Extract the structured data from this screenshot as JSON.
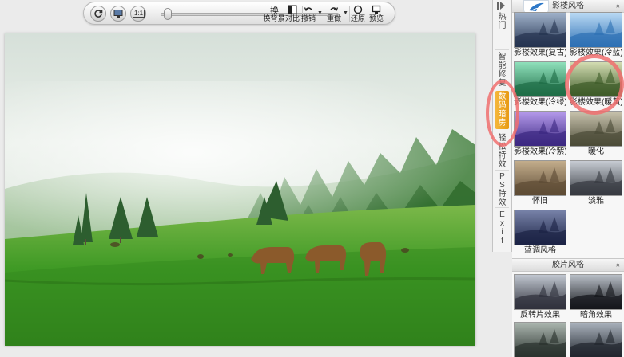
{
  "toolbar": {
    "rotate_icon": "rotate-icon",
    "fit_screen_icon": "monitor-icon",
    "actual_size_label": "1:1",
    "zoom_level": 0.04,
    "buttons": [
      {
        "label": "换背景",
        "icon": "swap-background-icon"
      },
      {
        "label": "对比",
        "icon": "compare-icon"
      },
      {
        "label": "撤销",
        "icon": "undo-icon"
      },
      {
        "label": "重做",
        "icon": "redo-icon"
      },
      {
        "label": "还原",
        "icon": "restore-icon"
      },
      {
        "label": "预览",
        "icon": "preview-icon"
      }
    ]
  },
  "tabs": [
    {
      "label": "热\n门",
      "active": false
    },
    {
      "label": "智\n能\n修\n复",
      "active": false
    },
    {
      "label": "数\n码\n暗\n房",
      "active": true
    },
    {
      "label": "轻\n松\n特\n效",
      "active": false
    },
    {
      "label": "P\nS\n特\n效",
      "active": false
    },
    {
      "label": "E\nx\ni\nf",
      "active": false
    }
  ],
  "panel": {
    "section1_title": "影楼风格",
    "section2_title": "胶片风格",
    "collapse_glyph": "«",
    "section1_items": [
      {
        "caption": "影楼效果(复古)",
        "colors": [
          "#23324f",
          "#9fb1c9"
        ]
      },
      {
        "caption": "影楼效果(冷蓝)",
        "colors": [
          "#2c6fb3",
          "#b9d9f4"
        ]
      },
      {
        "caption": "影楼效果(冷绿)",
        "colors": [
          "#1d6b45",
          "#8fe0bb"
        ]
      },
      {
        "caption": "影楼效果(暖黄)",
        "colors": [
          "#3c5a27",
          "#d3dcb2"
        ]
      },
      {
        "caption": "影楼效果(冷紫)",
        "colors": [
          "#3a2780",
          "#b59aeb"
        ]
      },
      {
        "caption": "暖化",
        "colors": [
          "#4a4a36",
          "#c8c2ad"
        ]
      },
      {
        "caption": "怀旧",
        "colors": [
          "#5c4a33",
          "#c3ad8c"
        ]
      },
      {
        "caption": "淡雅",
        "colors": [
          "#35383f",
          "#c7ccd3"
        ]
      },
      {
        "caption": "蓝调风格",
        "colors": [
          "#1b2244",
          "#7782a8"
        ]
      }
    ],
    "section2_items": [
      {
        "caption": "反转片效果",
        "colors": [
          "#2d2f3a",
          "#c0c6cf"
        ]
      },
      {
        "caption": "暗角效果",
        "colors": [
          "#111318",
          "#b8bec6"
        ]
      },
      {
        "caption": "",
        "colors": [
          "#28302c",
          "#aab5ae"
        ]
      },
      {
        "caption": "",
        "colors": [
          "#1f242c",
          "#a9b1bb"
        ]
      }
    ]
  },
  "colors": {
    "active_tab": "#f0a52a",
    "highlight": "#f06e6e"
  }
}
